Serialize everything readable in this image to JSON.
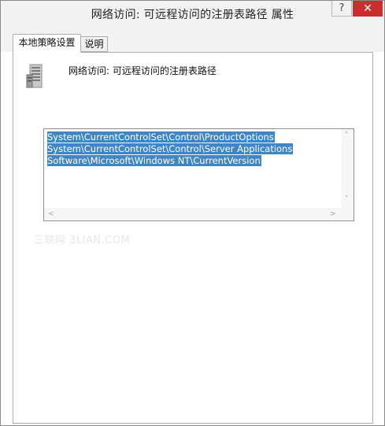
{
  "window": {
    "title": "网络访问: 可远程访问的注册表路径 属性",
    "help_label": "?",
    "close_label": "✕"
  },
  "tabs": [
    {
      "label": "本地策略设置",
      "active": true
    },
    {
      "label": "说明",
      "active": false
    }
  ],
  "policy": {
    "icon": "server-policy-icon",
    "name": "网络访问: 可远程访问的注册表路径"
  },
  "paths_box": {
    "lines": [
      "System\\CurrentControlSet\\Control\\ProductOptions",
      "System\\CurrentControlSet\\Control\\Server Applications",
      "Software\\Microsoft\\Windows NT\\CurrentVersion"
    ],
    "selection_color": "#3f86c6",
    "scroll_up": "˄",
    "scroll_down": "˅",
    "scroll_left": "<",
    "scroll_right": ">"
  },
  "watermark": "三联网 3LIAN.COM",
  "colors": {
    "close_button": "#c7302c",
    "chrome_background": "#f2f2f2"
  }
}
